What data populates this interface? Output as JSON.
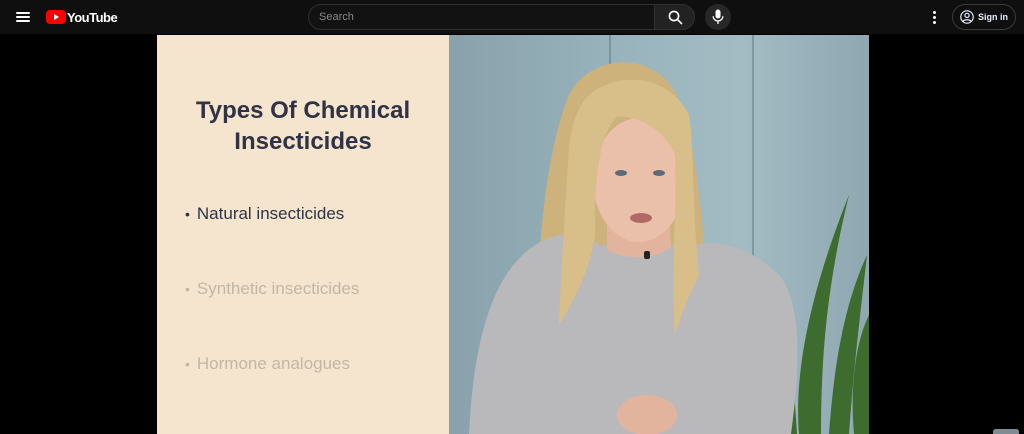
{
  "header": {
    "logo_text": "YouTube",
    "search_placeholder": "Search",
    "signin_label": "Sign in",
    "icons": [
      "menu-icon",
      "youtube-logo",
      "search-icon",
      "mic-icon",
      "more-vert-icon",
      "account-circle-icon"
    ]
  },
  "video": {
    "slide": {
      "title_line1": "Types Of Chemical",
      "title_line2": "Insecticides",
      "bullets": [
        "Natural insecticides",
        "Synthetic insecticides",
        "Hormone analogues"
      ]
    }
  },
  "colors": {
    "brand_red": "#ff0000",
    "topbar_bg": "#0f0f0f",
    "slide_bg": "#f5e5ce",
    "slide_text": "#2f3345",
    "slide_text_faded": "#c2b6a5"
  }
}
